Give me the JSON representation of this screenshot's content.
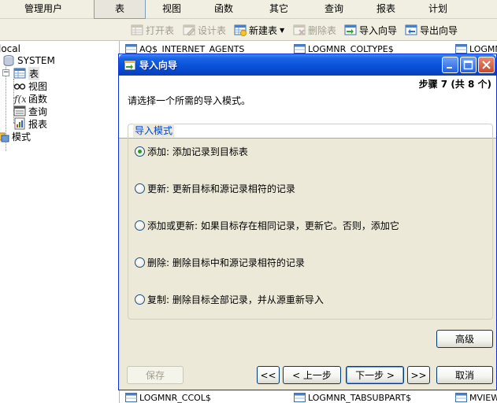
{
  "menu": {
    "tabs": [
      {
        "label": "管理用户"
      },
      {
        "label": "表",
        "active": true
      },
      {
        "label": "视图"
      },
      {
        "label": "函数"
      },
      {
        "label": "其它"
      },
      {
        "label": "查询"
      },
      {
        "label": "报表"
      },
      {
        "label": "计划"
      }
    ]
  },
  "toolbar": {
    "open_table": "打开表",
    "design_table": "设计表",
    "new_table": "新建表",
    "delete_table": "删除表",
    "import_wizard": "导入向导",
    "export_wizard": "导出向导"
  },
  "tree": {
    "connection": "local",
    "schema": "SYSTEM",
    "tables": "表",
    "views": "视图",
    "functions": "函数",
    "queries": "查询",
    "reports": "报表",
    "models": "模式"
  },
  "grid": {
    "top_items": [
      "AQ$_INTERNET_AGENTS",
      "LOGMNR_COLTYPE$",
      "LOGMN"
    ],
    "bottom_items": [
      "LOGMNR_CCOL$",
      "LOGMNR_TABSUBPART$",
      "MVIEW$"
    ]
  },
  "dialog": {
    "title": "导入向导",
    "step": "步骤 7 (共 8 个)",
    "instruction": "请选择一个所需的导入模式。",
    "group_label": "导入模式",
    "options": [
      {
        "label": "添加: 添加记录到目标表",
        "checked": true
      },
      {
        "label": "更新: 更新目标和源记录相符的记录",
        "checked": false
      },
      {
        "label": "添加或更新: 如果目标存在相同记录，更新它。否则，添加它",
        "checked": false
      },
      {
        "label": "删除: 删除目标中和源记录相符的记录",
        "checked": false
      },
      {
        "label": "复制: 删除目标全部记录，并从源重新导入",
        "checked": false
      }
    ],
    "advanced_button": "高级",
    "save_button": "保存",
    "first_button": "<<",
    "prev_button": "< 上一步",
    "next_button": "下一步 >",
    "last_button": ">>",
    "cancel_button": "取消"
  },
  "colors": {
    "accent": "#0a54dc",
    "group_label": "#0046d5",
    "dialog_bg": "#ece9d8"
  }
}
